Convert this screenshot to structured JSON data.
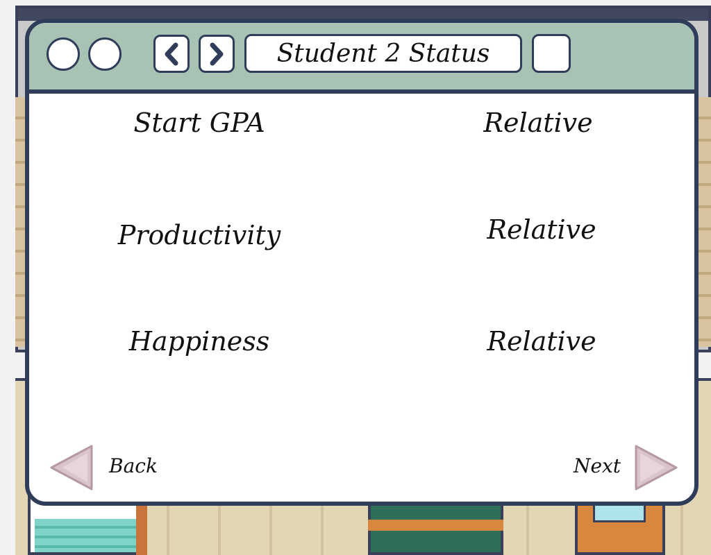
{
  "window": {
    "title": "Student 2 Status",
    "nav": {
      "prev_icon": "chevron-left-icon",
      "next_icon": "chevron-right-icon"
    }
  },
  "stats": [
    {
      "name": "Start GPA",
      "value": "Relative"
    },
    {
      "name": "Productivity",
      "value": "Relative"
    },
    {
      "name": "Happiness",
      "value": "Relative"
    }
  ],
  "footer": {
    "back_label": "Back",
    "next_label": "Next",
    "back_icon": "triangle-left-icon",
    "next_icon": "triangle-right-icon"
  },
  "colors": {
    "titlebar": "#a8c2b3",
    "border": "#2f3d5a",
    "arrow": "#d9c4cc"
  }
}
